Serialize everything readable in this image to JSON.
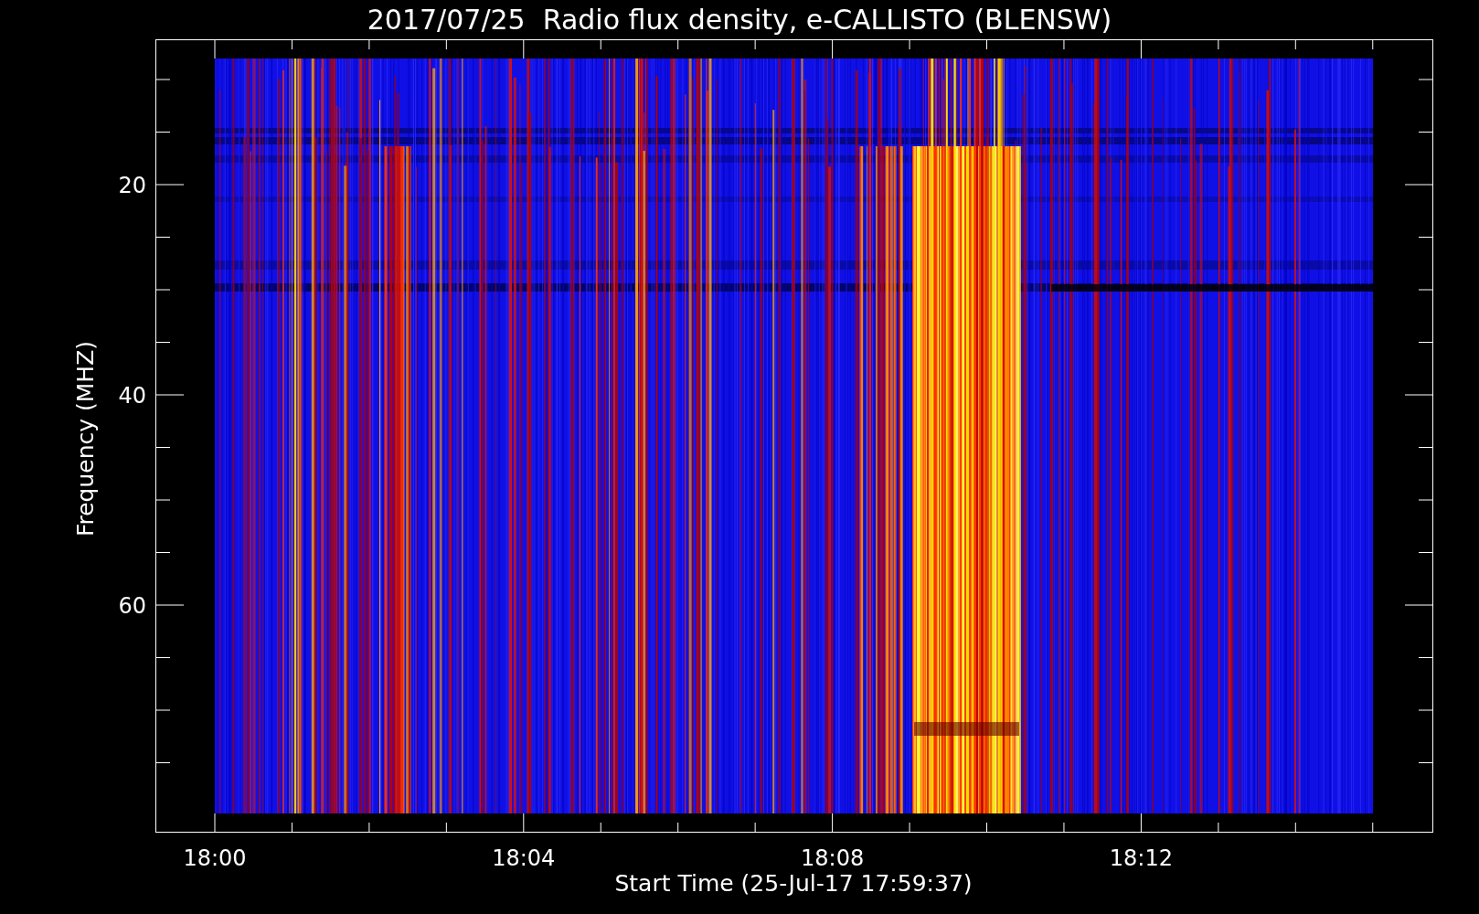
{
  "title": "2017/07/25  Radio flux density, e-CALLISTO (BLENSW)",
  "plot": {
    "ylabel": "Frequency (MHZ)",
    "xlabel": "Start Time (25-Jul-17 17:59:37)",
    "x_tick_labels": [
      "18:00",
      "18:04",
      "18:08",
      "18:12"
    ],
    "y_tick_labels": [
      "20",
      "40",
      "60"
    ]
  }
}
